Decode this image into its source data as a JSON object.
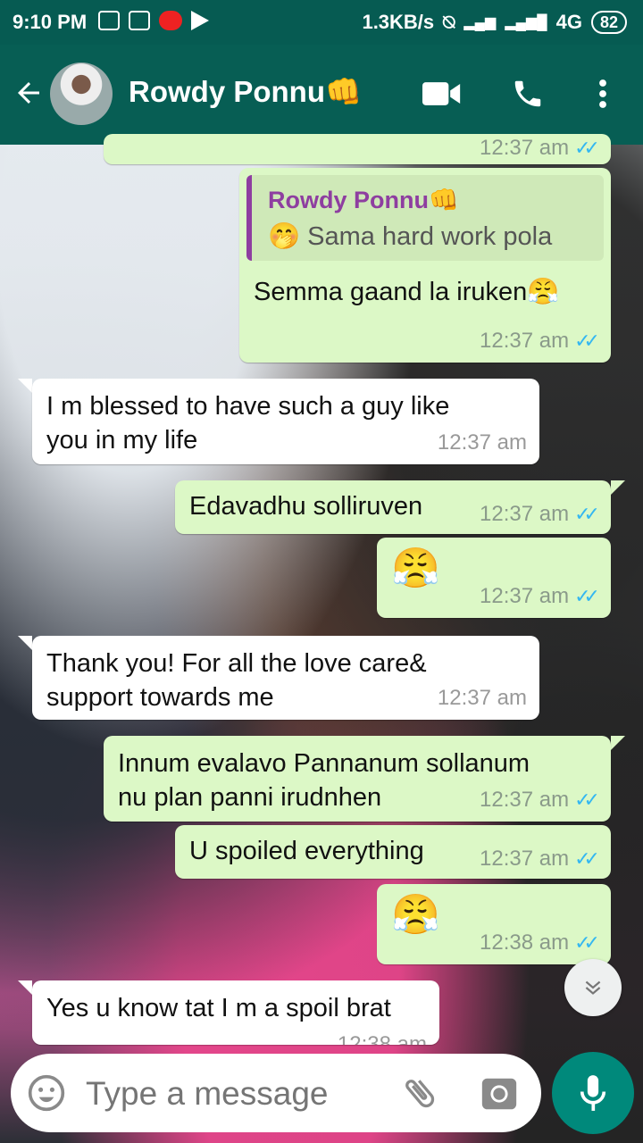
{
  "status_bar": {
    "time": "9:10 PM",
    "speed": "1.3KB/s",
    "network": "4G",
    "battery": "82"
  },
  "header": {
    "contact_name": "Rowdy Ponnu👊",
    "back_icon": "arrow-back-icon",
    "video_icon": "videocam-icon",
    "call_icon": "phone-icon",
    "menu_icon": "more-vert-icon"
  },
  "messages": [
    {
      "id": "m0",
      "direction": "out",
      "text": "",
      "time": "12:37 am",
      "ticks": "✓✓"
    },
    {
      "id": "m1",
      "direction": "out",
      "quote_name": "Rowdy Ponnu👊",
      "quote_text": "🤭 Sama hard work pola",
      "text": "Semma gaand la iruken😤",
      "time": "12:37 am",
      "ticks": "✓✓"
    },
    {
      "id": "m2",
      "direction": "in",
      "text": "I m blessed to have such a guy like\nyou in my life",
      "time": "12:37 am"
    },
    {
      "id": "m3",
      "direction": "out",
      "text": "Edavadhu solliruven",
      "time": "12:37 am",
      "ticks": "✓✓"
    },
    {
      "id": "m4",
      "direction": "out",
      "text": "😤",
      "time": "12:37 am",
      "ticks": "✓✓"
    },
    {
      "id": "m5",
      "direction": "in",
      "text": "Thank you!  For all the love care&\nsupport towards me",
      "time": "12:37 am"
    },
    {
      "id": "m6",
      "direction": "out",
      "text": "Innum evalavo Pannanum sollanum\nnu plan panni irudnhen",
      "time": "12:37 am",
      "ticks": "✓✓"
    },
    {
      "id": "m7",
      "direction": "out",
      "text": "U spoiled everything",
      "time": "12:37 am",
      "ticks": "✓✓"
    },
    {
      "id": "m8",
      "direction": "out",
      "text": "😤",
      "time": "12:38 am",
      "ticks": "✓✓"
    },
    {
      "id": "m9",
      "direction": "in",
      "text": "Yes u know tat I m a spoil brat",
      "time": "12:38 am"
    }
  ],
  "composer": {
    "placeholder": "Type a message",
    "emoji_icon": "emoji-icon",
    "attach_icon": "paperclip-icon",
    "camera_icon": "camera-icon",
    "mic_icon": "mic-icon"
  },
  "colors": {
    "header": "#075e54",
    "status_bar": "#065b52",
    "outgoing_bubble": "#dcf8c6",
    "incoming_bubble": "#ffffff",
    "read_ticks": "#34b7f1",
    "mic_button": "#00897b"
  }
}
